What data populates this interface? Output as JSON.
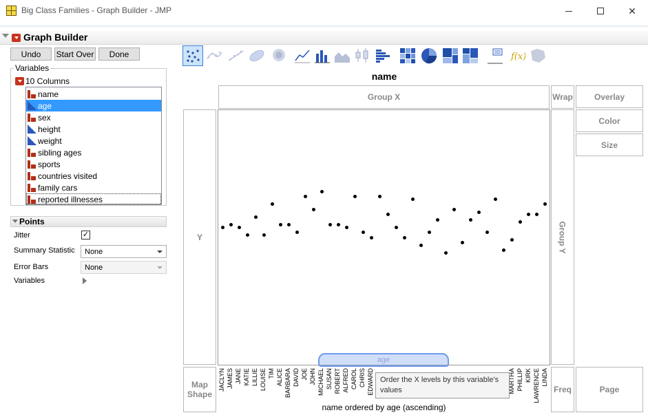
{
  "window": {
    "title": "Big Class Families - Graph Builder - JMP"
  },
  "header": {
    "title": "Graph Builder"
  },
  "buttons": {
    "undo": "Undo",
    "start_over": "Start Over",
    "done": "Done"
  },
  "variables": {
    "group_label": "Variables",
    "count_label": "10 Columns",
    "columns": [
      {
        "name": "name",
        "type": "nominal",
        "selected": false
      },
      {
        "name": "age",
        "type": "continuous",
        "selected": true
      },
      {
        "name": "sex",
        "type": "nominal",
        "selected": false
      },
      {
        "name": "height",
        "type": "continuous",
        "selected": false
      },
      {
        "name": "weight",
        "type": "continuous",
        "selected": false
      },
      {
        "name": "sibling ages",
        "type": "nominal",
        "selected": false
      },
      {
        "name": "sports",
        "type": "nominal",
        "selected": false
      },
      {
        "name": "countries visited",
        "type": "nominal",
        "selected": false
      },
      {
        "name": "family cars",
        "type": "nominal",
        "selected": false
      },
      {
        "name": "reported illnesses",
        "type": "nominal",
        "selected": false
      }
    ]
  },
  "points_panel": {
    "title": "Points",
    "jitter_label": "Jitter",
    "jitter_checked": true,
    "summary_label": "Summary Statistic",
    "summary_value": "None",
    "errorbars_label": "Error Bars",
    "errorbars_value": "None",
    "variables_label": "Variables"
  },
  "zones": {
    "group_x": "Group X",
    "wrap": "Wrap",
    "overlay": "Overlay",
    "color": "Color",
    "size": "Size",
    "y": "Y",
    "group_y": "Group Y",
    "map_shape": "Map Shape",
    "freq": "Freq",
    "page": "Page"
  },
  "graph": {
    "title": "name",
    "x_axis_title": "name ordered by age (ascending)",
    "drag_item": "age",
    "tooltip": "Order the X levels by this variable's values"
  },
  "chart_data": {
    "type": "scatter",
    "title": "name",
    "xlabel": "name ordered by age (ascending)",
    "ylabel": "",
    "categories": [
      "JACLYN",
      "JAMES",
      "JANE",
      "KATIE",
      "LILLIE",
      "LOUISE",
      "TIM",
      "ALICE",
      "BARBARA",
      "DAVID",
      "JOE",
      "JOHN",
      "MICHAEL",
      "SUSAN",
      "ROBERT",
      "ALFRED",
      "CAROL",
      "CHRIS",
      "EDWARD",
      "",
      "",
      "",
      "",
      "",
      "",
      "",
      "",
      "",
      "",
      "",
      "",
      "",
      "",
      "",
      "",
      "MARTHA",
      "PHILLIP",
      "KIRK",
      "LAWRENCE",
      "LINDA"
    ],
    "y_rel": [
      0.54,
      0.55,
      0.54,
      0.51,
      0.58,
      0.51,
      0.63,
      0.55,
      0.55,
      0.52,
      0.66,
      0.61,
      0.68,
      0.55,
      0.55,
      0.54,
      0.66,
      0.52,
      0.5,
      0.66,
      0.59,
      0.54,
      0.5,
      0.65,
      0.47,
      0.52,
      0.57,
      0.44,
      0.61,
      0.48,
      0.57,
      0.6,
      0.52,
      0.65,
      0.45,
      0.49,
      0.56,
      0.59,
      0.59,
      0.63
    ]
  }
}
